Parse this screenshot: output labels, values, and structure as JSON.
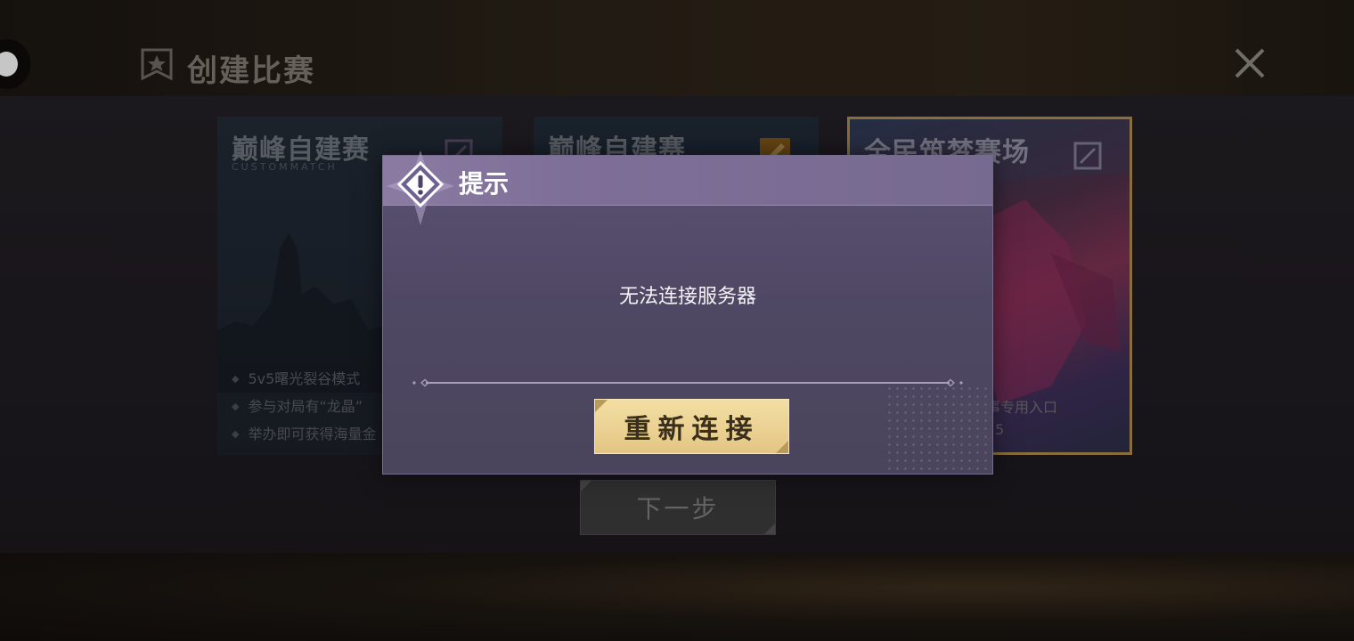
{
  "header": {
    "title": "创建比赛",
    "icon": "star-banner-icon",
    "close_icon": "close-icon"
  },
  "cards": [
    {
      "title": "巅峰自建赛",
      "subtitle": "CUSTOMMATCH",
      "features": [
        "5v5曙光裂谷模式",
        "参与对局有“龙晶”",
        "举办即可获得海量金"
      ]
    },
    {
      "title": "巅峰自建赛",
      "subtitle": "",
      "features": []
    },
    {
      "title": "全民筑梦赛场",
      "subtitle": "",
      "features": [
        "事专用入口",
        "5"
      ]
    }
  ],
  "next_button": {
    "label": "下一步"
  },
  "dialog": {
    "title": "提示",
    "message": "无法连接服务器",
    "button_label": "重新连接",
    "icon": "exclamation-diamond-icon"
  },
  "colors": {
    "dialog_bg": "#4f4864",
    "dialog_header": "#8b7ba3",
    "button_gold": "#ead091",
    "card_border_selected": "#a5874a"
  }
}
